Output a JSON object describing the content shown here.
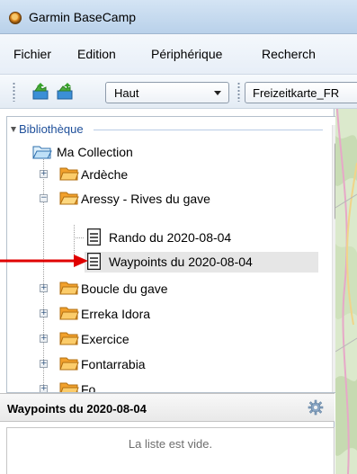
{
  "window": {
    "title": "Garmin BaseCamp"
  },
  "menu": {
    "items": [
      "Fichier",
      "Edition",
      "Périphérique",
      "Recherch"
    ]
  },
  "toolbar": {
    "dropdown_value": "Haut",
    "map_field_value": "Freizeitkarte_FR"
  },
  "library": {
    "root_label": "Bibliothèque",
    "collection_label": "Ma Collection",
    "items": [
      {
        "label": "Ardèche",
        "kind": "folder",
        "expander": "+"
      },
      {
        "label": "Aressy - Rives du gave",
        "kind": "folder-open",
        "expander": "−"
      },
      {
        "label": "Rando du 2020-08-04",
        "kind": "list"
      },
      {
        "label": "Waypoints du 2020-08-04",
        "kind": "list",
        "selected": true
      },
      {
        "label": "Boucle du gave",
        "kind": "folder",
        "expander": "+"
      },
      {
        "label": "Erreka Idora",
        "kind": "folder",
        "expander": "+"
      },
      {
        "label": "Exercice",
        "kind": "folder",
        "expander": "+"
      },
      {
        "label": "Fontarrabia",
        "kind": "folder",
        "expander": "+"
      },
      {
        "label": "Fo...",
        "kind": "folder",
        "expander": "+"
      }
    ]
  },
  "detail": {
    "title": "Waypoints du 2020-08-04",
    "empty_message": "La liste est vide."
  },
  "colors": {
    "highlight_arrow": "#e00000",
    "folder": "#f7b23a",
    "selection": "#e6e6e6"
  },
  "icons": [
    "app-icon",
    "new-list-icon",
    "new-folder-icon",
    "folder-icon",
    "open-folder-icon",
    "list-icon",
    "gear-icon",
    "chevron-down-icon"
  ]
}
